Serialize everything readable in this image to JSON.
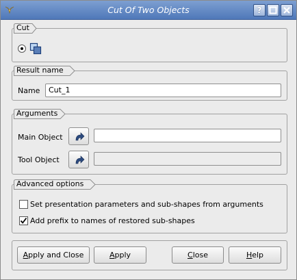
{
  "window": {
    "title": "Cut Of Two Objects",
    "controls": {
      "help": "?",
      "maximize": "maximize",
      "close": "close"
    }
  },
  "cut_group": {
    "title": "Cut",
    "radio_selected": true,
    "icon": "boolean-cut-icon"
  },
  "result_group": {
    "title": "Result name",
    "name_label": "Name",
    "name_value": "Cut_1"
  },
  "arguments_group": {
    "title": "Arguments",
    "main_object_label": "Main Object",
    "main_object_value": "",
    "tool_object_label": "Tool Object",
    "tool_object_value": "",
    "select_icon": "arrow-select-icon"
  },
  "advanced_group": {
    "title": "Advanced options",
    "set_presentation_label": "Set presentation parameters and sub-shapes from arguments",
    "set_presentation_checked": false,
    "add_prefix_label": "Add prefix to names of restored sub-shapes",
    "add_prefix_checked": true
  },
  "buttons": {
    "apply_and_close": {
      "mnemonic": "A",
      "rest": "pply and Close"
    },
    "apply": {
      "mnemonic": "A",
      "rest": "pply"
    },
    "close": {
      "mnemonic": "C",
      "rest": "lose"
    },
    "help": {
      "mnemonic": "H",
      "rest": "elp"
    }
  }
}
